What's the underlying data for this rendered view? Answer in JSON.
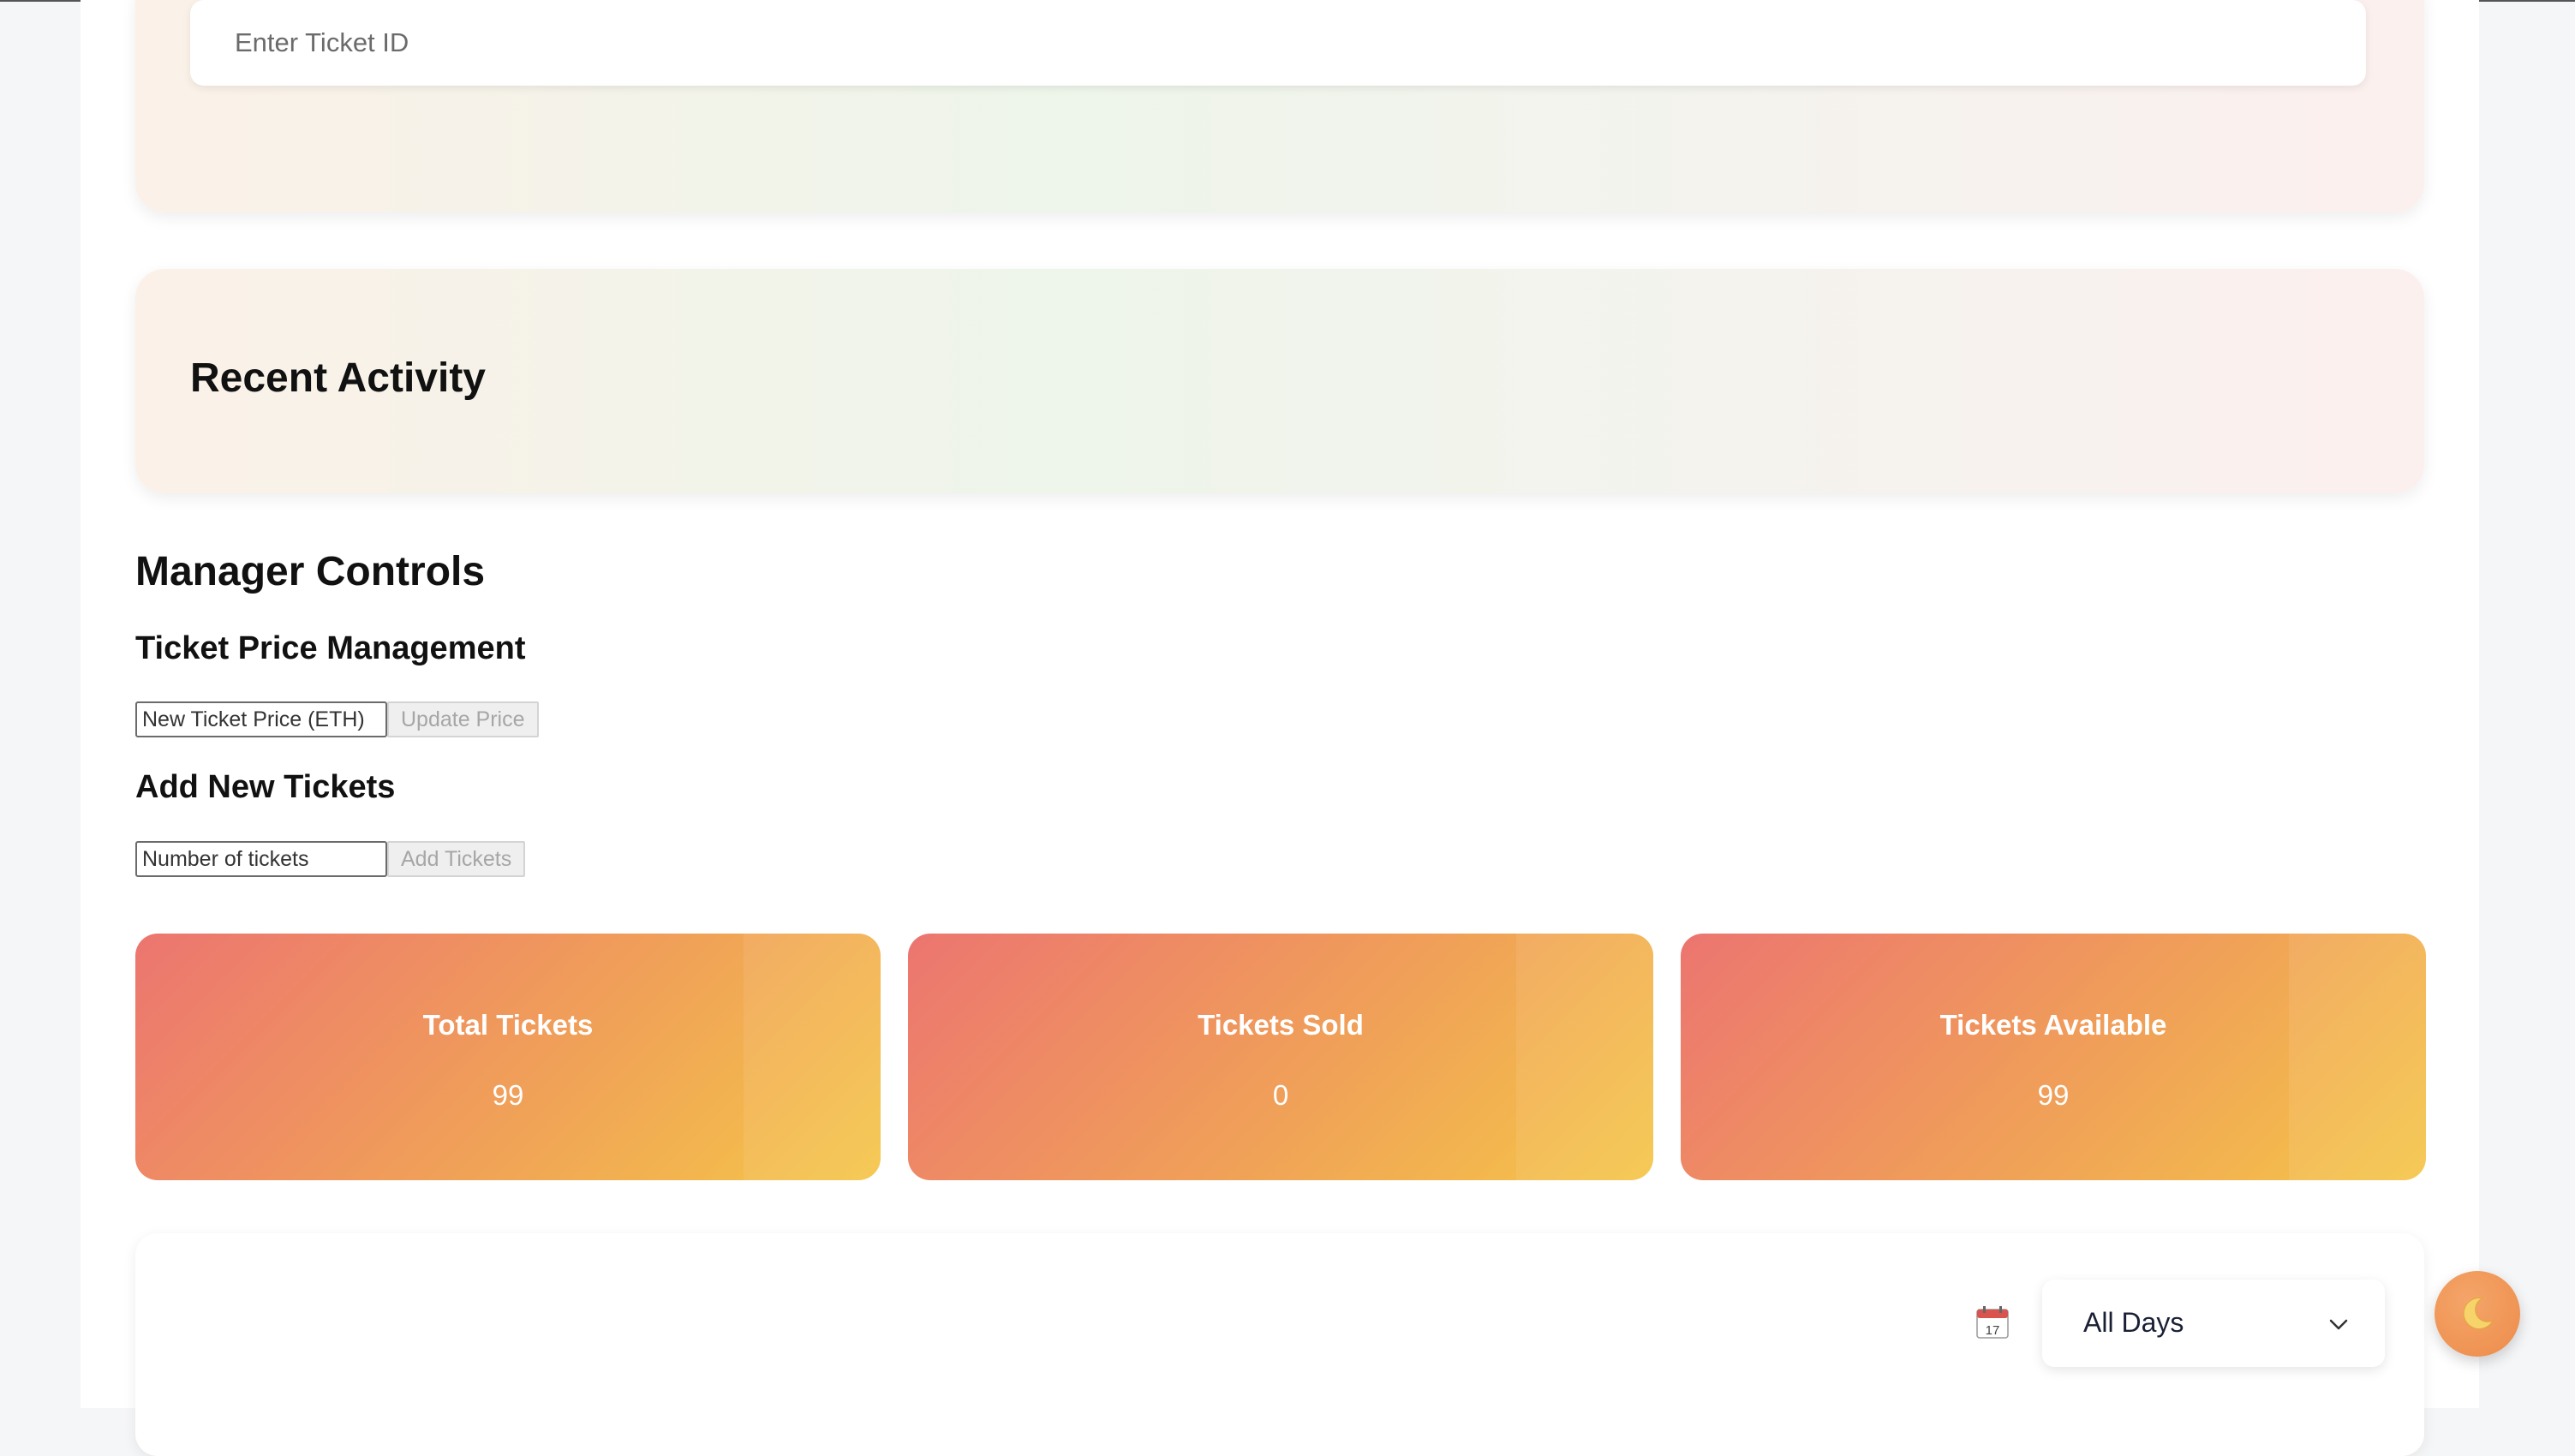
{
  "search": {
    "placeholder": "Enter Ticket ID"
  },
  "activity": {
    "title": "Recent Activity"
  },
  "manager": {
    "title": "Manager Controls",
    "price_section": {
      "title": "Ticket Price Management",
      "input_placeholder": "New Ticket Price (ETH)",
      "button_label": "Update Price"
    },
    "add_section": {
      "title": "Add New Tickets",
      "input_placeholder": "Number of tickets",
      "button_label": "Add Tickets"
    }
  },
  "stats": [
    {
      "label": "Total Tickets",
      "value": "99"
    },
    {
      "label": "Tickets Sold",
      "value": "0"
    },
    {
      "label": "Tickets Available",
      "value": "99"
    }
  ],
  "filter": {
    "icon": "calendar-icon",
    "calendar_day": "17",
    "selected": "All Days"
  },
  "theme_toggle": {
    "icon": "moon-icon"
  },
  "colors": {
    "stat_gradient_start": "#ec7570",
    "stat_gradient_mid": "#f0a058",
    "stat_gradient_end": "#f5c648",
    "toggle_bg": "#ec8c4a"
  }
}
